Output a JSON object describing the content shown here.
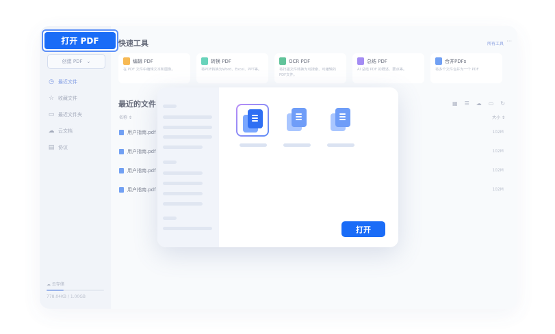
{
  "open_pdf_button": "打开 PDF",
  "sidebar": {
    "new_pdf": "创建 PDF",
    "items": [
      {
        "label": "最近文件",
        "icon": "clock-icon",
        "active": true
      },
      {
        "label": "收藏文件",
        "icon": "star-icon",
        "active": false
      },
      {
        "label": "最近文件夹",
        "icon": "folder-icon",
        "active": false
      },
      {
        "label": "云文档",
        "icon": "cloud-icon",
        "active": false
      },
      {
        "label": "协议",
        "icon": "document-icon",
        "active": false
      }
    ],
    "storage_label": "云存储",
    "storage_used": "778.04KB / 1.00GB",
    "storage_fraction": 0.3
  },
  "quick_tools": {
    "title": "快速工具",
    "all_tools": "所有工具",
    "more": "···",
    "cards": [
      {
        "name": "编辑 PDF",
        "desc": "在 PDF 文件中编辑文本和图像。",
        "color": "#f5a623"
      },
      {
        "name": "转换 PDF",
        "desc": "将PDF转换为Word、Excel、PPT等。",
        "color": "#3fc7a8"
      },
      {
        "name": "OCR PDF",
        "desc": "将扫描文件转换为可搜索、可编辑的PDF文件。",
        "color": "#36b37e"
      },
      {
        "name": "总结 PDF",
        "desc": "AI 总结 PDF 的概述、要点等。",
        "color": "#8b6cf0"
      },
      {
        "name": "合并PDFs",
        "desc": "将多个文件合并为一个 PDF",
        "color": "#4a86f0"
      }
    ]
  },
  "recent": {
    "title": "最近的文件",
    "col_name": "名称 ⇕",
    "col_size": "大小 ⇕",
    "files": [
      {
        "name": "用户指南.pdf",
        "size": "102M"
      },
      {
        "name": "用户指南.pdf",
        "size": "102M"
      },
      {
        "name": "用户指南.pdf",
        "size": "102M"
      },
      {
        "name": "用户指南.pdf",
        "size": "102M"
      }
    ]
  },
  "dialog": {
    "open_button": "打开"
  },
  "colors": {
    "accent": "#1a6cf7",
    "accent_border": "#5b8ff7"
  }
}
